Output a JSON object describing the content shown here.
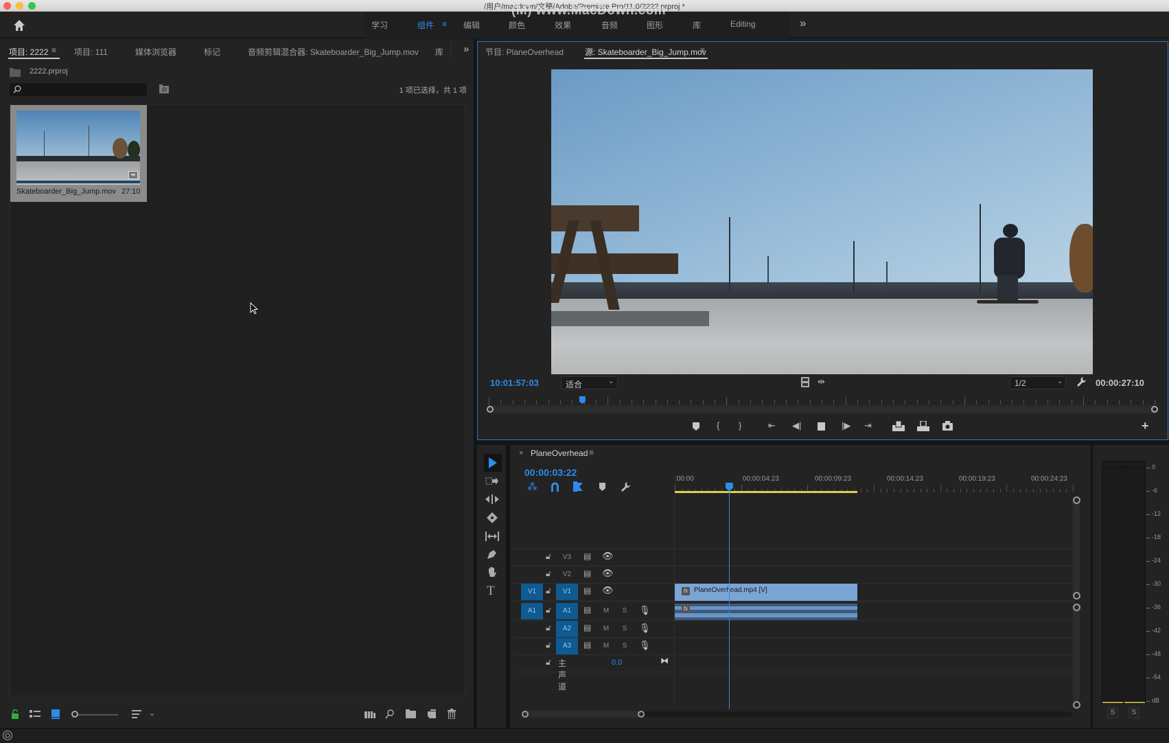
{
  "window": {
    "title": "/用户/macdown/文稿/Adobe/Premiere Pro/11.0/2222.prproj *",
    "watermark": "(M) www.MacDown.com"
  },
  "workspaces": {
    "tabs": [
      {
        "label": "学习",
        "active": false
      },
      {
        "label": "组件",
        "active": true
      },
      {
        "label": "编辑",
        "active": false
      },
      {
        "label": "颜色",
        "active": false
      },
      {
        "label": "效果",
        "active": false
      },
      {
        "label": "音频",
        "active": false
      },
      {
        "label": "图形",
        "active": false
      },
      {
        "label": "库",
        "active": false
      },
      {
        "label": "Editing",
        "active": false
      }
    ],
    "menu_glyph": "≡",
    "overflow_glyph": "»"
  },
  "project_panel": {
    "tabs": [
      {
        "label": "项目: 2222",
        "active": true
      },
      {
        "label": "项目: 111",
        "active": false
      },
      {
        "label": "媒体浏览器",
        "active": false
      },
      {
        "label": "标记",
        "active": false
      },
      {
        "label": "音频剪辑混合器: Skateboarder_Big_Jump.mov",
        "active": false
      },
      {
        "label": "库",
        "active": false
      }
    ],
    "project_file": "2222.prproj",
    "search": {
      "value": "",
      "placeholder": ""
    },
    "selection_status": "1 项已选择，共 1 项",
    "items": [
      {
        "name": "Skateboarder_Big_Jump.mov",
        "duration": "27:10"
      }
    ]
  },
  "source_monitor": {
    "tabs": [
      {
        "label": "节目: PlaneOverhead",
        "active": false
      },
      {
        "label": "源: Skateboarder_Big_Jump.mov",
        "active": true
      }
    ],
    "current_timecode": "10:01:57:03",
    "zoom_select": "适合",
    "resolution_select": "1/2",
    "duration": "00:00:27:10",
    "playhead_fraction": 0.14
  },
  "timeline": {
    "sequence_name": "PlaneOverhead",
    "close_glyph": "×",
    "timecode": "00:00:03:22",
    "ruler_labels": [
      ":00:00",
      "00:00:04:23",
      "00:00:09:23",
      "00:00:14:23",
      "00:00:19:23",
      "00:00:24:23"
    ],
    "playhead_fraction": 0.136,
    "work_area_end_fraction": 0.458,
    "video_tracks": [
      {
        "src": "",
        "name": "V3"
      },
      {
        "src": "",
        "name": "V2"
      },
      {
        "src": "V1",
        "name": "V1"
      }
    ],
    "audio_tracks": [
      {
        "src": "A1",
        "name": "A1",
        "m": "M",
        "s": "S"
      },
      {
        "src": "",
        "name": "A2",
        "m": "M",
        "s": "S"
      },
      {
        "src": "",
        "name": "A3",
        "m": "M",
        "s": "S"
      }
    ],
    "master": {
      "label": "主声道",
      "value": "0.0"
    },
    "clips": [
      {
        "track": "V1",
        "label": "PlaneOverhead.mp4 [V]",
        "fx": "fx"
      },
      {
        "track": "A1",
        "label": "",
        "fx": "fx"
      }
    ]
  },
  "audio_meter": {
    "scale": [
      "0",
      "-6",
      "-12",
      "-18",
      "-24",
      "-30",
      "-36",
      "-42",
      "-48",
      "-54",
      "dB"
    ],
    "solo_labels": [
      "S",
      "S"
    ]
  }
}
